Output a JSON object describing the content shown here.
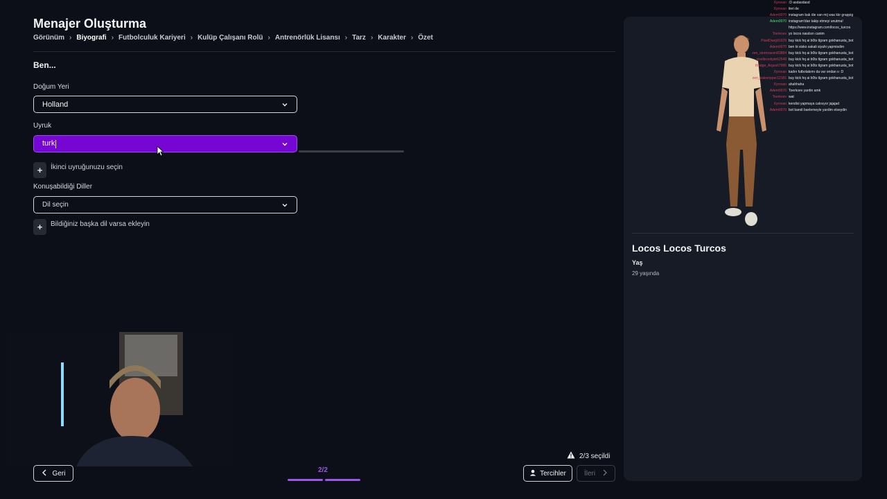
{
  "header": {
    "title": "Menajer Oluşturma",
    "breadcrumb": [
      "Görünüm",
      "Biyografi",
      "Futbolculuk Kariyeri",
      "Kulüp Çalışanı Rolü",
      "Antrenörlük Lisansı",
      "Tarz",
      "Karakter",
      "Özet"
    ],
    "active_crumb": "Biyografi"
  },
  "form": {
    "section_title": "Ben...",
    "birthplace_label": "Doğum Yeri",
    "birthplace_value": "Holland",
    "nationality_label": "Uyruk",
    "nationality_value": "turk",
    "add_nationality": "İkinci uyruğunuzu seçin",
    "languages_label": "Konuşabildiği Diller",
    "languages_placeholder": "Dil seçin",
    "add_language": "Bildiğiniz başka dil varsa ekleyin",
    "accent_color": "#7506d4"
  },
  "profile": {
    "name": "Locos Locos Turcos",
    "age_label": "Yaş",
    "age_value": "29 yaşında"
  },
  "footer": {
    "back_label": "Geri",
    "page_indicator": "2/2",
    "selected_count": "2/3 seçildi",
    "prefs_label": "Tercihler",
    "next_label": "İleri",
    "progress_color": "#9a57f0"
  },
  "chat": [
    {
      "user": "Xyrovan",
      "msg": ":D asdasdasd"
    },
    {
      "user": "Xyrovan",
      "msg": "ileri de"
    },
    {
      "user": "Adem0070",
      "msg": "instagram bak die van mij was kkr grappig"
    },
    {
      "user": "Adem0070",
      "msg": "instagram'dan takip etmeyi unutma!"
    },
    {
      "user": "",
      "msg": "https://www.instagram.com/locos_turcos"
    },
    {
      "user": "Toerkoev",
      "msg": "yo locos nasılsın canim"
    },
    {
      "user": "PixelDiarg91929",
      "msg": "buy kick hq ai b0ts tlgram gokhanusta_bot"
    },
    {
      "user": "Adem0070",
      "msg": "ben bi sisko sakali siyahi yapmisdim"
    },
    {
      "user": "zen_stormraven83884",
      "msg": "buy kick hq ai b0ts tlgram gokhanusta_bot"
    },
    {
      "user": "pixelbronbyte62549",
      "msg": "buy kick hq ai b0ts tlgram gokhanusta_bot"
    },
    {
      "user": "thedge_Argus67986",
      "msg": "buy kick hq ai b0ts tlgram gokhanusta_bot"
    },
    {
      "user": "Xyrovan",
      "msg": "kadın futbolakımı da var ondan o :D"
    },
    {
      "user": "zen_valevripper12181",
      "msg": "buy kick hq ai b0ts tlgram gokhanusta_bot"
    },
    {
      "user": "Xyrovan",
      "msg": "ahahhaha"
    },
    {
      "user": "Adem0070",
      "msg": "Toerkoev yardin amk"
    },
    {
      "user": "Toerkoev",
      "msg": "wat"
    },
    {
      "user": "Xyrovan",
      "msg": "kendisi yapmaya calısıyor jajajad"
    },
    {
      "user": "Adem0070",
      "msg": "bot bandi banlemeyle yardim etseydin"
    }
  ]
}
